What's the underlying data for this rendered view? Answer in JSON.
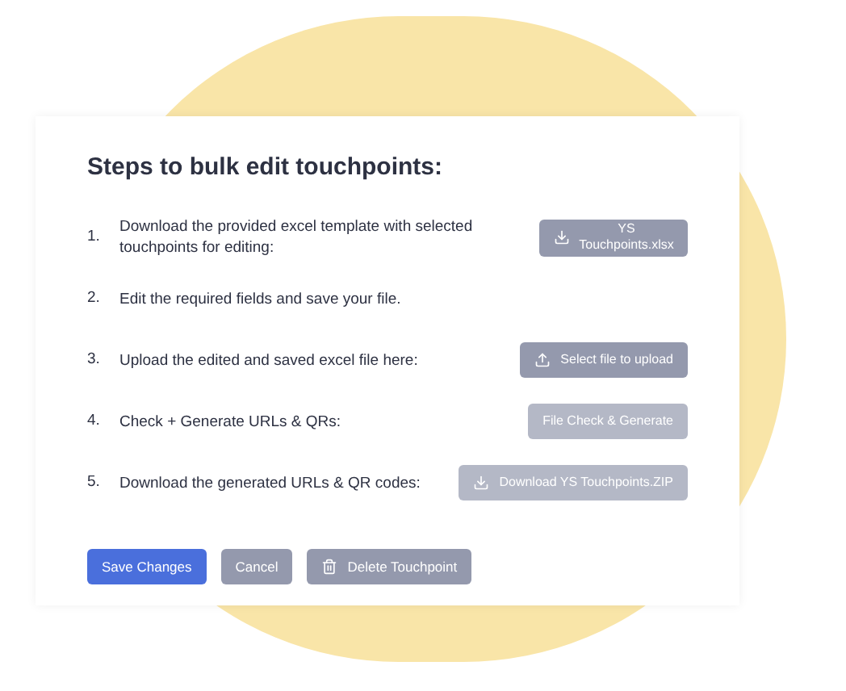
{
  "title": "Steps to bulk edit touchpoints:",
  "steps": [
    {
      "number": "1.",
      "text": "Download the provided excel template with selected touchpoints for editing:",
      "button": {
        "label": "YS Touchpoints.xlsx",
        "kind": "download",
        "disabled": false
      }
    },
    {
      "number": "2.",
      "text": "Edit the required fields and save your file."
    },
    {
      "number": "3.",
      "text": "Upload the edited and saved excel file here:",
      "button": {
        "label": "Select file to upload",
        "kind": "upload",
        "disabled": false
      }
    },
    {
      "number": "4.",
      "text": "Check + Generate URLs & QRs:",
      "button": {
        "label": "File Check & Generate",
        "kind": "check",
        "disabled": true
      }
    },
    {
      "number": "5.",
      "text": "Download the generated URLs & QR codes:",
      "button": {
        "label": "Download YS Touchpoints.ZIP",
        "kind": "download",
        "disabled": true
      }
    }
  ],
  "actions": [
    {
      "label": "Save Changes",
      "kind": "save"
    },
    {
      "label": "Cancel",
      "kind": "cancel"
    },
    {
      "label": "Delete Touchpoint",
      "kind": "delete"
    }
  ]
}
